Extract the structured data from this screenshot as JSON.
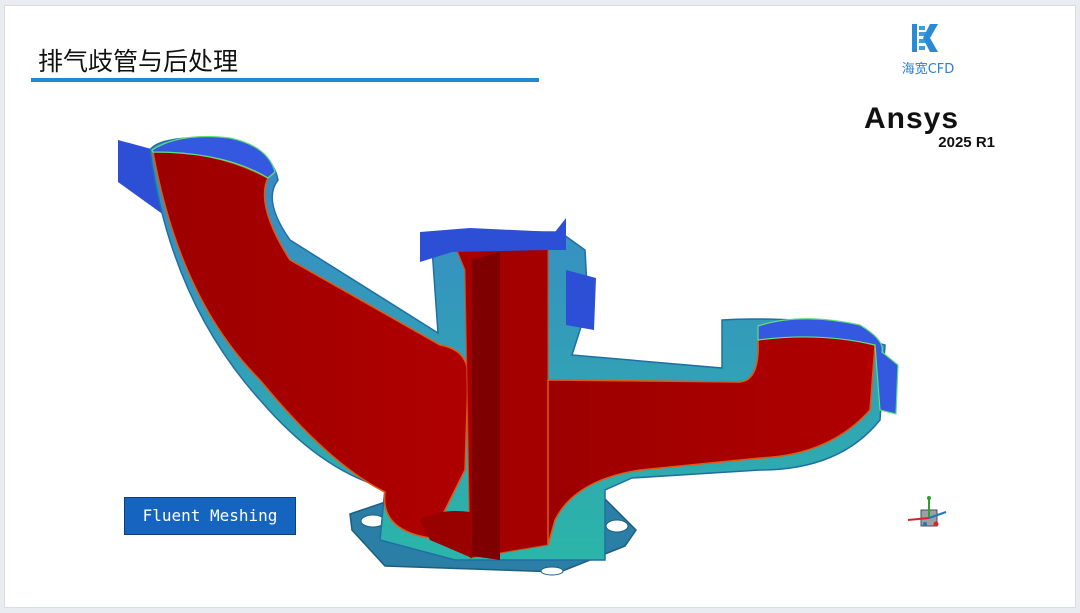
{
  "slide": {
    "title": "排气歧管与后处理",
    "accent_color": "#1f8ad0"
  },
  "logos": {
    "haikuan_text": "海宽CFD",
    "ansys_name": "Ansys",
    "ansys_version": "2025 R1"
  },
  "viewport": {
    "mesh_label": "Fluent Meshing",
    "colors": {
      "core": "#a10000",
      "wall": "#2aa7b6",
      "inlet": "#2c4fd6",
      "label_bg": "#1565c0"
    },
    "triad_axes": [
      "x",
      "y",
      "z"
    ]
  }
}
